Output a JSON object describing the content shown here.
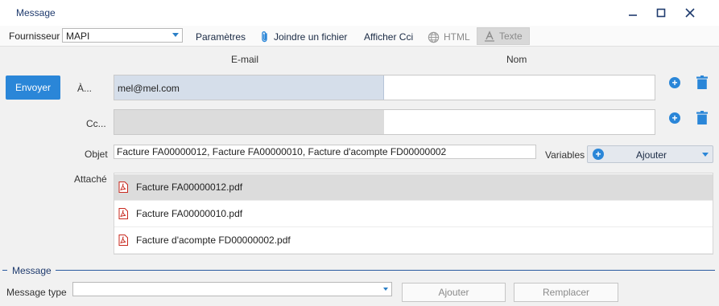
{
  "window": {
    "title": "Message",
    "minimize": "—",
    "maximize": "☐",
    "close": "✕"
  },
  "toolbar": {
    "provider_label": "Fournisseur",
    "provider_value": "MAPI",
    "settings": "Paramètres",
    "attach_file": "Joindre un fichier",
    "show_bcc": "Afficher Cci",
    "html": "HTML",
    "text": "Texte"
  },
  "columns": {
    "email": "E-mail",
    "name": "Nom"
  },
  "send_button": "Envoyer",
  "to": {
    "label": "À...",
    "email": "mel@mel.com",
    "name": ""
  },
  "cc": {
    "label": "Cc...",
    "email": "",
    "name": ""
  },
  "subject": {
    "label": "Objet",
    "value": "Facture FA00000012, Facture FA00000010, Facture d'acompte FD00000002"
  },
  "variables": {
    "label": "Variables",
    "button": "Ajouter"
  },
  "attachments": {
    "label": "Attaché",
    "items": [
      "Facture FA00000012.pdf",
      "Facture FA00000010.pdf",
      "Facture d'acompte FD00000002.pdf"
    ]
  },
  "message_section": {
    "title": "Message",
    "type_label": "Message type",
    "type_value": "",
    "add_button": "Ajouter",
    "replace_button": "Remplacer"
  },
  "colors": {
    "accent": "#2a86d8",
    "title": "#1f3b6e",
    "selected_email_bg": "#d5deea"
  }
}
